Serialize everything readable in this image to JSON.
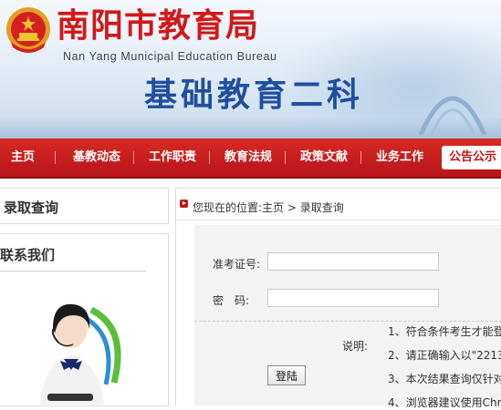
{
  "header": {
    "title": "南阳市教育局",
    "subtitle": "Nan Yang Municipal Education Bureau",
    "department": "基础教育二科"
  },
  "nav": {
    "items": [
      "主页",
      "基教动态",
      "工作职责",
      "教育法规",
      "政策文献",
      "业务工作",
      "公告公示"
    ],
    "active_index": 6
  },
  "sidebar": {
    "query_title": "录取查询",
    "contact_title": "联系我们"
  },
  "breadcrumb": {
    "text": "您现在的位置:主页 > 录取查询"
  },
  "form": {
    "exam_no_label": "准考证号:",
    "exam_no_value": "",
    "password_label": "密　码:",
    "password_value": "",
    "login_label": "登陆",
    "note_label": "说明:",
    "notes": [
      "1、符合条件考生才能登",
      "2、请正确输入以\"2213",
      "3、本次结果查询仅针对",
      "4、浏览器建议使用Chro"
    ]
  },
  "colors": {
    "nav_red": "#c0141a",
    "title_red": "#d21818",
    "dept_blue": "#1f4f9e"
  },
  "icons": {
    "emblem": "national-emblem-icon",
    "breadcrumb": "breadcrumb-arrow-icon"
  }
}
